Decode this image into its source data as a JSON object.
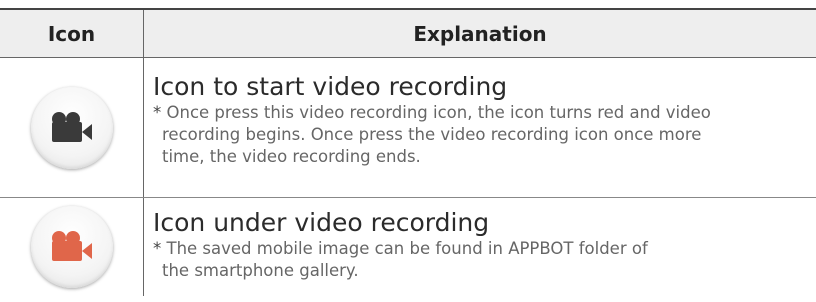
{
  "header": {
    "icon_col": "Icon",
    "explanation_col": "Explanation"
  },
  "rows": [
    {
      "icon": "video-camera-icon",
      "icon_color": "#3a3a3a",
      "title": "Icon to start video recording",
      "note_star": "*",
      "note_lines": [
        " Once press this video recording icon, the icon turns red and video",
        "recording begins. Once press the video recording icon once more",
        "time, the video recording ends."
      ]
    },
    {
      "icon": "video-camera-recording-icon",
      "icon_color": "#e0664a",
      "title": "Icon under video recording",
      "note_star": "*",
      "note_lines": [
        " The saved mobile image can be found in APPBOT folder of",
        "the smartphone gallery."
      ]
    }
  ]
}
